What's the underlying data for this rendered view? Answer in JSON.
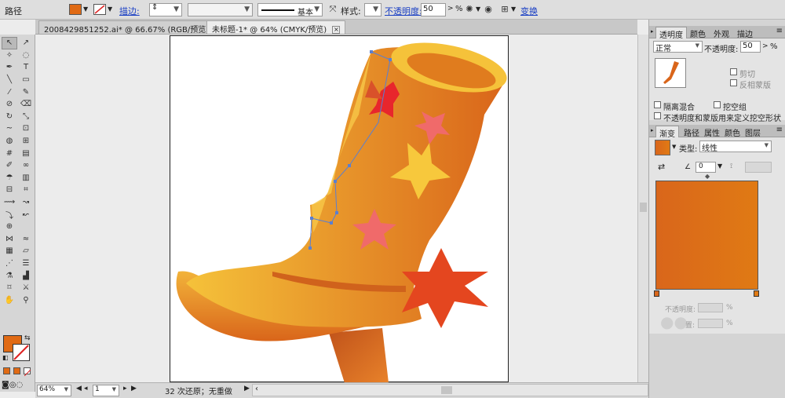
{
  "control_bar": {
    "object_type": "路径",
    "fill_color": "#e06a14",
    "stroke_label": "描边:",
    "stroke_weight": "",
    "brush_label": "基本",
    "style_label": "样式:",
    "opacity_label": "不透明度:",
    "opacity_value": "50",
    "opacity_unit": "%",
    "transform_label": "变换"
  },
  "tabs": [
    {
      "title": "2008429851252.ai* @ 66.67% (RGB/预览)"
    },
    {
      "title": "未标题-1* @ 64% (CMYK/预览)"
    }
  ],
  "status": {
    "zoom": "64%",
    "page": "1",
    "undo_text": "32 次还原；无重做"
  },
  "panels": {
    "top_tabs": [
      "透明度",
      "颜色",
      "外观",
      "描边"
    ],
    "blend_mode": "正常",
    "opacity_label": "不透明度:",
    "opacity_value": "50",
    "opacity_unit": "%",
    "clip_label": "剪切",
    "invert_mask_label": "反相蒙版",
    "isolate_label": "隔离混合",
    "knockout_label": "挖空组",
    "define_knockout_label": "不透明度和蒙版用来定义挖空形状",
    "gradient_tabs": [
      "渐变",
      "路径",
      "属性",
      "颜色",
      "图层"
    ],
    "type_label": "类型:",
    "type_value": "线性",
    "angle_value": "0",
    "gradient_start": "#d9661b",
    "gradient_end": "#e07a14",
    "bottom_opacity_label": "不透明度:",
    "bottom_opacity_unit": "%",
    "bottom_position_label": "置:",
    "bottom_position_unit": "%"
  },
  "artwork": {
    "boot_light": "#f5c23a",
    "boot_mid": "#f0a12e",
    "boot_dark": "#d9651a",
    "star_pink": "#f06a6a",
    "star_yellow": "#f7c83c",
    "star_red": "#e8262c",
    "spur_color": "#e4461f"
  }
}
